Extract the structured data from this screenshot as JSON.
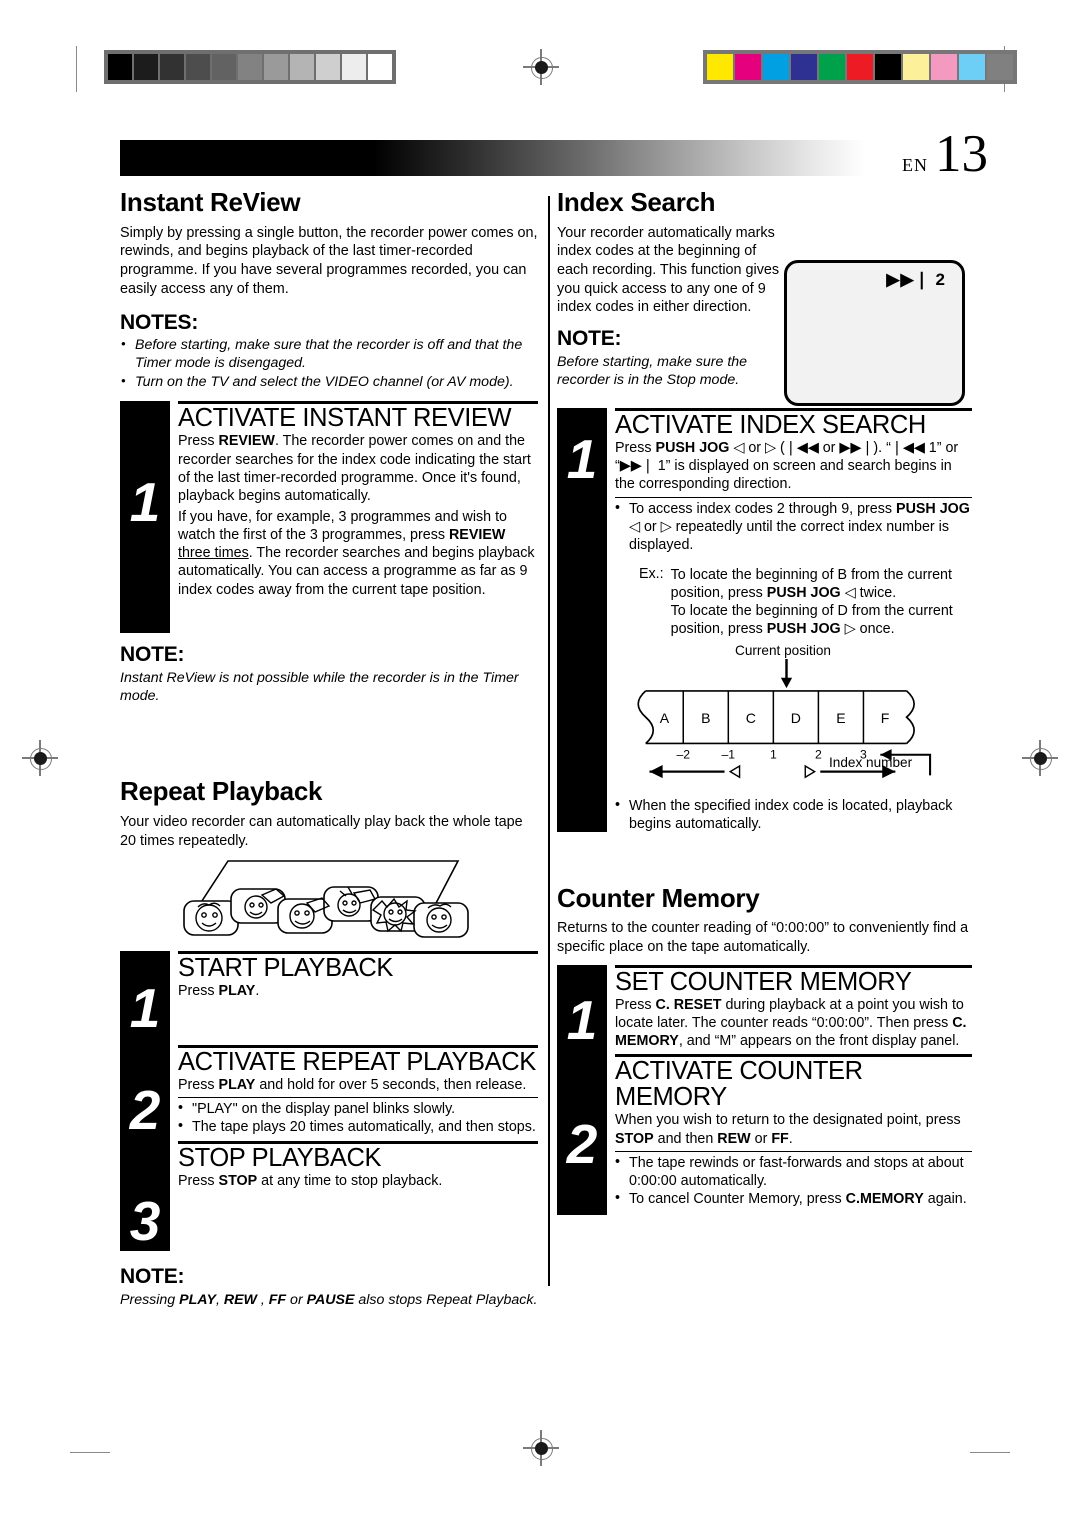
{
  "page": {
    "folio_prefix": "EN",
    "folio_number": "13"
  },
  "calibration": {
    "gray_patches": [
      "#000000",
      "#1c1c1c",
      "#323232",
      "#4d4d4d",
      "#626262",
      "#828282",
      "#9a9a9a",
      "#b4b4b4",
      "#cfcfcf",
      "#ededed",
      "#ffffff"
    ],
    "color_patches": [
      "#ffe800",
      "#e5007d",
      "#00a0e2",
      "#2e3192",
      "#00a14b",
      "#ed1c24",
      "#000000",
      "#fdf09a",
      "#f49ac1",
      "#6dcff6",
      "#808080"
    ]
  },
  "left_column": {
    "instant_review": {
      "title": "Instant ReView",
      "intro": "Simply by pressing a single button, the recorder power comes on, rewinds, and begins playback of the last timer-recorded programme. If you have several programmes recorded, you can easily access any of them.",
      "notes_heading": "NOTES:",
      "notes": [
        "Before starting, make sure that the recorder is off and that the Timer mode is disengaged.",
        "Turn on the TV and select the VIDEO channel (or AV mode)."
      ],
      "step1_title": "ACTIVATE INSTANT REVIEW",
      "step1_number": "1",
      "step1_para1_parts": [
        "Press ",
        "REVIEW",
        ". The recorder power comes on and the recorder searches for the index code indicating the start of the last timer-recorded programme. Once it's found, playback begins automatically."
      ],
      "step1_para2_parts": [
        "If you have, for example, 3 programmes and wish to watch the first of the 3 programmes, press ",
        "REVIEW",
        " ",
        "three times",
        ". The recorder searches and begins playback automatically. You can access a programme as far as 9 index codes away from the current tape position."
      ],
      "note_heading": "NOTE:",
      "note_text": "Instant ReView is not possible while the recorder is in the Timer mode."
    },
    "repeat_playback": {
      "title": "Repeat Playback",
      "intro": "Your video recorder can automatically play back the whole tape 20 times repeatedly.",
      "step1_number": "1",
      "step1_title": "START PLAYBACK",
      "step1_text_parts": [
        "Press ",
        "PLAY",
        "."
      ],
      "step2_number": "2",
      "step2_title": "ACTIVATE REPEAT PLAYBACK",
      "step2_text_parts": [
        "Press ",
        "PLAY",
        " and hold for over 5 seconds, then release."
      ],
      "step2_bullets": [
        "\"PLAY\" on the display panel blinks slowly.",
        "The tape plays 20 times automatically, and then stops."
      ],
      "step3_number": "3",
      "step3_title": "STOP PLAYBACK",
      "step3_text_parts": [
        "Press ",
        "STOP",
        " at any time to stop playback."
      ],
      "note_heading": "NOTE:",
      "note_parts": [
        "Pressing ",
        "PLAY",
        ", ",
        "REW",
        " , ",
        "FF",
        " or ",
        "PAUSE",
        " also stops Repeat Playback."
      ]
    }
  },
  "right_column": {
    "index_search": {
      "title": "Index Search",
      "intro": "Your recorder automatically marks index codes at the beginning of each recording. This function gives you quick access to any one of 9 index codes in either direction.",
      "note_heading": "NOTE:",
      "note_text": "Before starting, make sure the recorder is in the Stop mode.",
      "screen_indicator": "▶▶❘ 2",
      "step1_number": "1",
      "step1_title": "ACTIVATE INDEX SEARCH",
      "step1_para_parts": [
        "Press ",
        "PUSH JOG",
        " ◁ or ▷ (❘◀◀ or ▶▶❘). “❘◀◀ 1” or “▶▶❘ 1” is displayed on screen and search begins in the corresponding direction."
      ],
      "bullet1_parts": [
        "To access index codes 2 through 9, press ",
        "PUSH JOG",
        " ◁ or ▷ repeatedly until the correct index number is displayed."
      ],
      "example_label": "Ex.:",
      "example_line1_parts": [
        "To locate the beginning of B from the current position, press  ",
        "PUSH JOG",
        " ◁ twice."
      ],
      "example_line2_parts": [
        "To locate the beginning of D from the current position, press ",
        "PUSH JOG",
        " ▷ once."
      ],
      "diagram": {
        "current_position_label": "Current position",
        "segments": [
          "A",
          "B",
          "C",
          "D",
          "E",
          "F"
        ],
        "index_numbers": [
          "–2",
          "–1",
          "1",
          "2",
          "3"
        ],
        "index_number_label": "Index number",
        "left_arrow_glyph": "◁",
        "right_arrow_glyph": "▷"
      },
      "bullet2": "When the specified index code is located, playback begins automatically."
    },
    "counter_memory": {
      "title": "Counter Memory",
      "intro": "Returns to the counter reading of “0:00:00” to conveniently find a specific place on the tape automatically.",
      "step1_number": "1",
      "step1_title": "SET COUNTER MEMORY",
      "step1_parts": [
        "Press ",
        "C. RESET",
        " during playback at a point you wish to locate later. The counter reads “0:00:00”. Then press ",
        "C. MEMORY",
        ", and “M” appears on the front display panel."
      ],
      "step2_number": "2",
      "step2_title": "ACTIVATE COUNTER MEMORY",
      "step2_parts": [
        "When you wish to return to the designated point, press ",
        "STOP",
        " and then ",
        "REW",
        " or ",
        "FF",
        "."
      ],
      "step2_bullets_parts": [
        [
          "The tape rewinds or fast-forwards and stops at about 0:00:00 automatically."
        ],
        [
          "To cancel Counter Memory, press ",
          "C.MEMORY",
          " again."
        ]
      ]
    }
  }
}
